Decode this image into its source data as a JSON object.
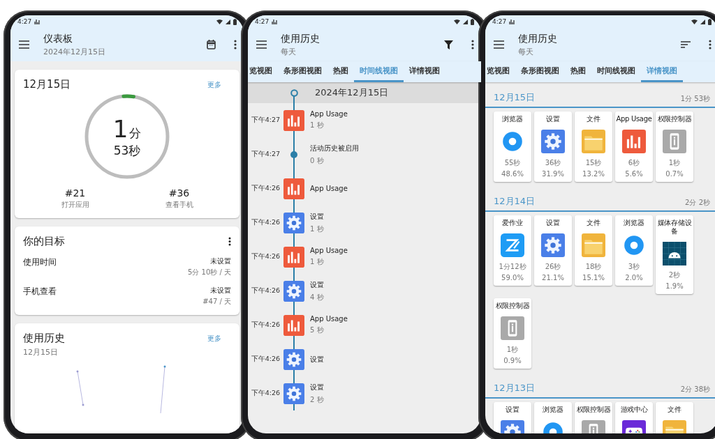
{
  "phones": [
    {
      "kind": "dashboard",
      "status_bar": {
        "time": "4:27"
      },
      "app_bar": {
        "title": "仪表板",
        "subtitle": "2024年12月15日"
      },
      "today_card": {
        "date": "12月15日",
        "more": "更多",
        "progress": {
          "level": 0.04
        },
        "minutes": "1",
        "minutes_unit": "分",
        "seconds": "53秒",
        "stats": [
          {
            "value": "#21",
            "label": "打开应用"
          },
          {
            "value": "#36",
            "label": "查看手机"
          }
        ]
      },
      "goals_card": {
        "title": "你的目标",
        "goals": [
          {
            "name": "使用时间",
            "status": "未设置",
            "target": "5分 10秒 / 天"
          },
          {
            "name": "手机查看",
            "status": "未设置",
            "target": "#47 / 天"
          }
        ]
      },
      "history_card": {
        "title": "使用历史",
        "date": "12月15日",
        "more": "更多"
      }
    },
    {
      "kind": "timeline",
      "status_bar": {
        "time": "4:27"
      },
      "app_bar": {
        "title": "使用历史",
        "subtitle": "每天"
      },
      "tabs": [
        {
          "label": "览视图",
          "selected": false
        },
        {
          "label": "条形图视图",
          "selected": false
        },
        {
          "label": "热图",
          "selected": false
        },
        {
          "label": "时间线视图",
          "selected": true
        },
        {
          "label": "详情视图",
          "selected": false
        }
      ],
      "day": "2024年12月15日",
      "entries": [
        {
          "time": "下午4:27",
          "kind": "usage",
          "name": "App Usage",
          "duration": "1 秒"
        },
        {
          "time": "下午4:27",
          "kind": "event",
          "name": "活动历史被启用",
          "duration": "0 秒"
        },
        {
          "time": "下午4:26",
          "kind": "usage",
          "name": "App Usage"
        },
        {
          "time": "下午4:26",
          "kind": "settings",
          "name": "设置",
          "duration": "1 秒"
        },
        {
          "time": "下午4:26",
          "kind": "usage",
          "name": "App Usage",
          "duration": "1 秒"
        },
        {
          "time": "下午4:26",
          "kind": "settings",
          "name": "设置",
          "duration": "4 秒"
        },
        {
          "time": "下午4:26",
          "kind": "usage",
          "name": "App Usage",
          "duration": "5 秒"
        },
        {
          "time": "下午4:26",
          "kind": "settings",
          "name": "设置"
        },
        {
          "time": "下午4:26",
          "kind": "settings",
          "name": "设置",
          "duration": "2 秒"
        }
      ]
    },
    {
      "kind": "details",
      "status_bar": {
        "time": "4:27"
      },
      "app_bar": {
        "title": "使用历史",
        "subtitle": "每天"
      },
      "tabs": [
        {
          "label": "览视图",
          "selected": false
        },
        {
          "label": "条形图视图",
          "selected": false
        },
        {
          "label": "热图",
          "selected": false
        },
        {
          "label": "时间线视图",
          "selected": false
        },
        {
          "label": "详情视图",
          "selected": true
        }
      ],
      "sections": [
        {
          "date": "12月15日",
          "total": "1分 53秒",
          "apps": [
            {
              "name": "浏览器",
              "kind": "browser",
              "time": "55秒",
              "share": "48.6%"
            },
            {
              "name": "设置",
              "kind": "settings",
              "time": "36秒",
              "share": "31.9%"
            },
            {
              "name": "文件",
              "kind": "files",
              "time": "15秒",
              "share": "13.2%"
            },
            {
              "name": "App Usage",
              "kind": "usage",
              "time": "6秒",
              "share": "5.6%"
            },
            {
              "name": "权限控制器",
              "kind": "permission",
              "time": "1秒",
              "share": "0.7%"
            }
          ]
        },
        {
          "date": "12月14日",
          "total": "2分 2秒",
          "apps": [
            {
              "name": "爱作业",
              "kind": "homework",
              "time": "1分12秒",
              "share": "59.0%"
            },
            {
              "name": "设置",
              "kind": "settings",
              "time": "26秒",
              "share": "21.1%"
            },
            {
              "name": "文件",
              "kind": "files",
              "time": "18秒",
              "share": "15.1%"
            },
            {
              "name": "浏览器",
              "kind": "browser",
              "time": "3秒",
              "share": "2.0%"
            },
            {
              "name": "媒体存储设备",
              "kind": "android",
              "time": "2秒",
              "share": "1.9%"
            },
            {
              "name": "权限控制器",
              "kind": "permission",
              "time": "1秒",
              "share": "0.9%"
            }
          ]
        },
        {
          "date": "12月13日",
          "total": "2分 38秒",
          "apps": [
            {
              "name": "设置",
              "kind": "settings"
            },
            {
              "name": "浏览器",
              "kind": "browser"
            },
            {
              "name": "权限控制器",
              "kind": "permission"
            },
            {
              "name": "游戏中心",
              "kind": "game"
            },
            {
              "name": "文件",
              "kind": "files"
            }
          ]
        }
      ]
    }
  ]
}
